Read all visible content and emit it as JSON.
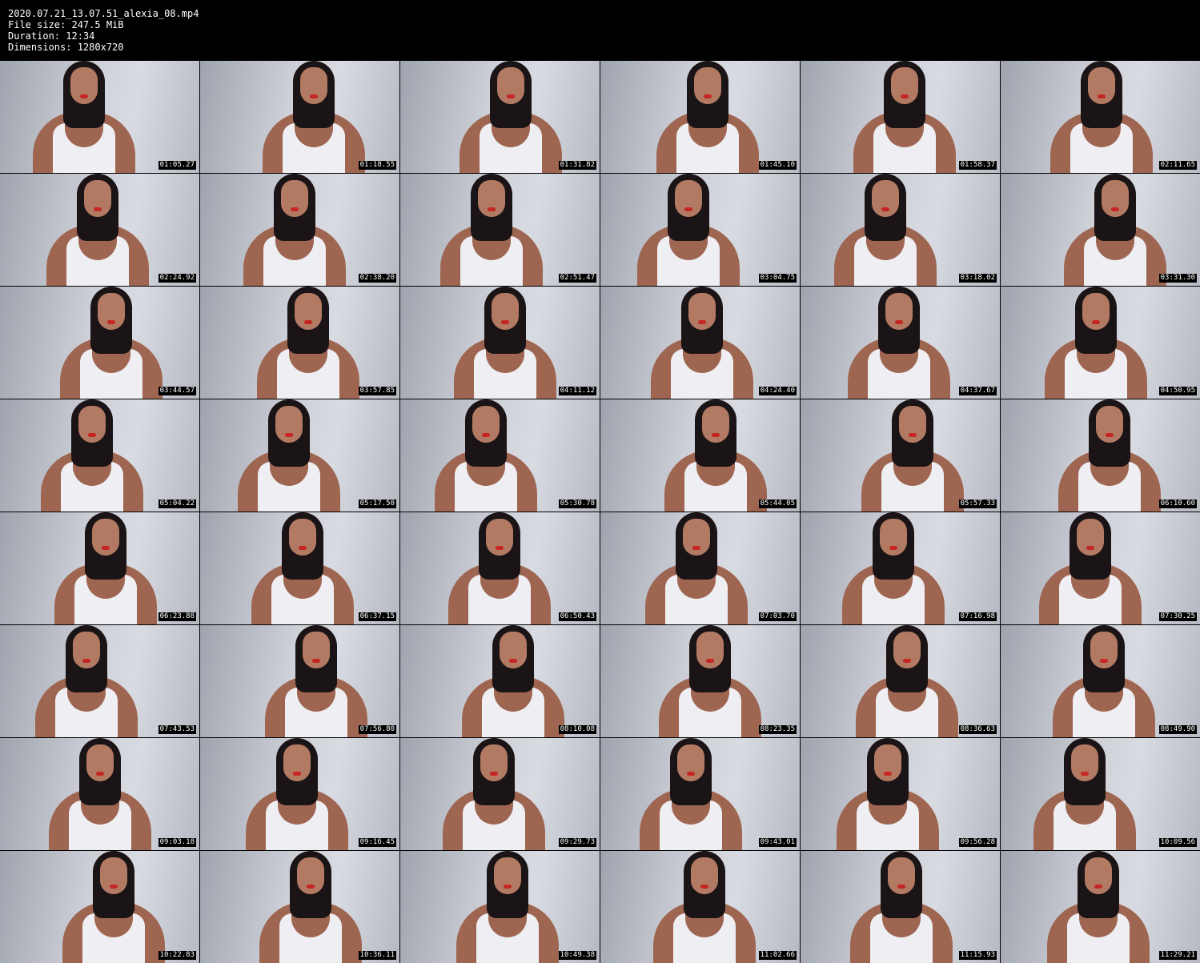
{
  "header": {
    "filename": "2020.07.21_13.07.51_alexia_08.mp4",
    "file_size": "File size: 247.5 MiB",
    "duration": "Duration: 12:34",
    "dimensions": "Dimensions: 1280x720"
  },
  "thumbnails": [
    {
      "timestamp": "01:05.27"
    },
    {
      "timestamp": "01:18.55"
    },
    {
      "timestamp": "01:31.82"
    },
    {
      "timestamp": "01:45.10"
    },
    {
      "timestamp": "01:58.37"
    },
    {
      "timestamp": "02:11.65"
    },
    {
      "timestamp": "02:24.92"
    },
    {
      "timestamp": "02:38.20"
    },
    {
      "timestamp": "02:51.47"
    },
    {
      "timestamp": "03:04.75"
    },
    {
      "timestamp": "03:18.02"
    },
    {
      "timestamp": "03:31.30"
    },
    {
      "timestamp": "03:44.57"
    },
    {
      "timestamp": "03:57.85"
    },
    {
      "timestamp": "04:11.12"
    },
    {
      "timestamp": "04:24.40"
    },
    {
      "timestamp": "04:37.67"
    },
    {
      "timestamp": "04:50.95"
    },
    {
      "timestamp": "05:04.22"
    },
    {
      "timestamp": "05:17.50"
    },
    {
      "timestamp": "05:30.78"
    },
    {
      "timestamp": "05:44.05"
    },
    {
      "timestamp": "05:57.33"
    },
    {
      "timestamp": "06:10.60"
    },
    {
      "timestamp": "06:23.88"
    },
    {
      "timestamp": "06:37.15"
    },
    {
      "timestamp": "06:50.43"
    },
    {
      "timestamp": "07:03.70"
    },
    {
      "timestamp": "07:16.98"
    },
    {
      "timestamp": "07:30.25"
    },
    {
      "timestamp": "07:43.53"
    },
    {
      "timestamp": "07:56.80"
    },
    {
      "timestamp": "08:10.08"
    },
    {
      "timestamp": "08:23.35"
    },
    {
      "timestamp": "08:36.63"
    },
    {
      "timestamp": "08:49.90"
    },
    {
      "timestamp": "09:03.18"
    },
    {
      "timestamp": "09:16.45"
    },
    {
      "timestamp": "09:29.73"
    },
    {
      "timestamp": "09:43.01"
    },
    {
      "timestamp": "09:56.28"
    },
    {
      "timestamp": "10:09.56"
    },
    {
      "timestamp": "10:22.83"
    },
    {
      "timestamp": "10:36.11"
    },
    {
      "timestamp": "10:49.38"
    },
    {
      "timestamp": "11:02.66"
    },
    {
      "timestamp": "11:15.93"
    },
    {
      "timestamp": "11:29.21"
    }
  ],
  "colors": {
    "background": "#000000",
    "text": "#ffffff",
    "wall": "#cfd1d9",
    "hair": "#1b1416",
    "skin": "#a46d57",
    "tank_top": "#eeeef3",
    "lips": "#c52624"
  }
}
